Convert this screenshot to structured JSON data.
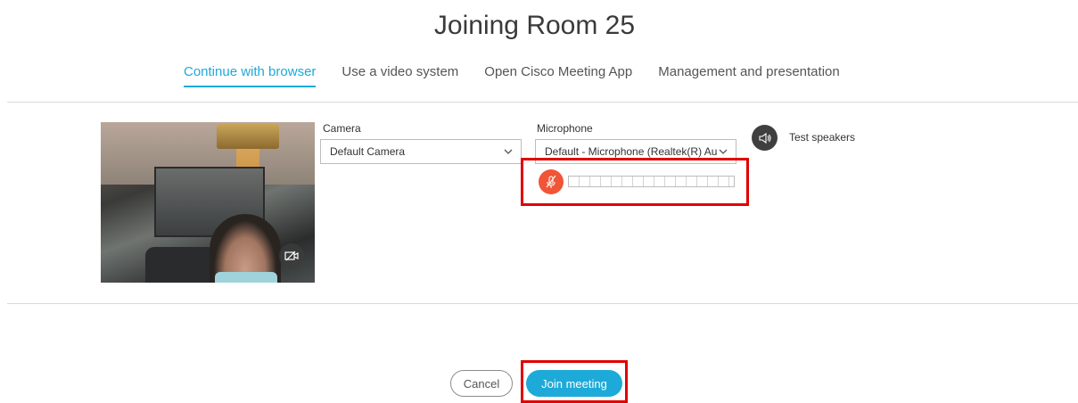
{
  "title": "Joining Room 25",
  "tabs": [
    {
      "label": "Continue with browser",
      "active": true
    },
    {
      "label": "Use a video system",
      "active": false
    },
    {
      "label": "Open Cisco Meeting App",
      "active": false
    },
    {
      "label": "Management and presentation",
      "active": false
    }
  ],
  "camera": {
    "label": "Camera",
    "selected": "Default Camera"
  },
  "microphone": {
    "label": "Microphone",
    "selected": "Default - Microphone (Realtek(R) Au",
    "muted": true,
    "level": 0
  },
  "speakers": {
    "label": "Test speakers"
  },
  "actions": {
    "cancel": "Cancel",
    "join": "Join meeting"
  },
  "colors": {
    "accent": "#1eaad8",
    "mute_red": "#f05537",
    "highlight": "#e00000"
  },
  "icons": [
    "camera-off-icon",
    "mic-muted-icon",
    "speaker-icon",
    "chevron-down-icon"
  ]
}
